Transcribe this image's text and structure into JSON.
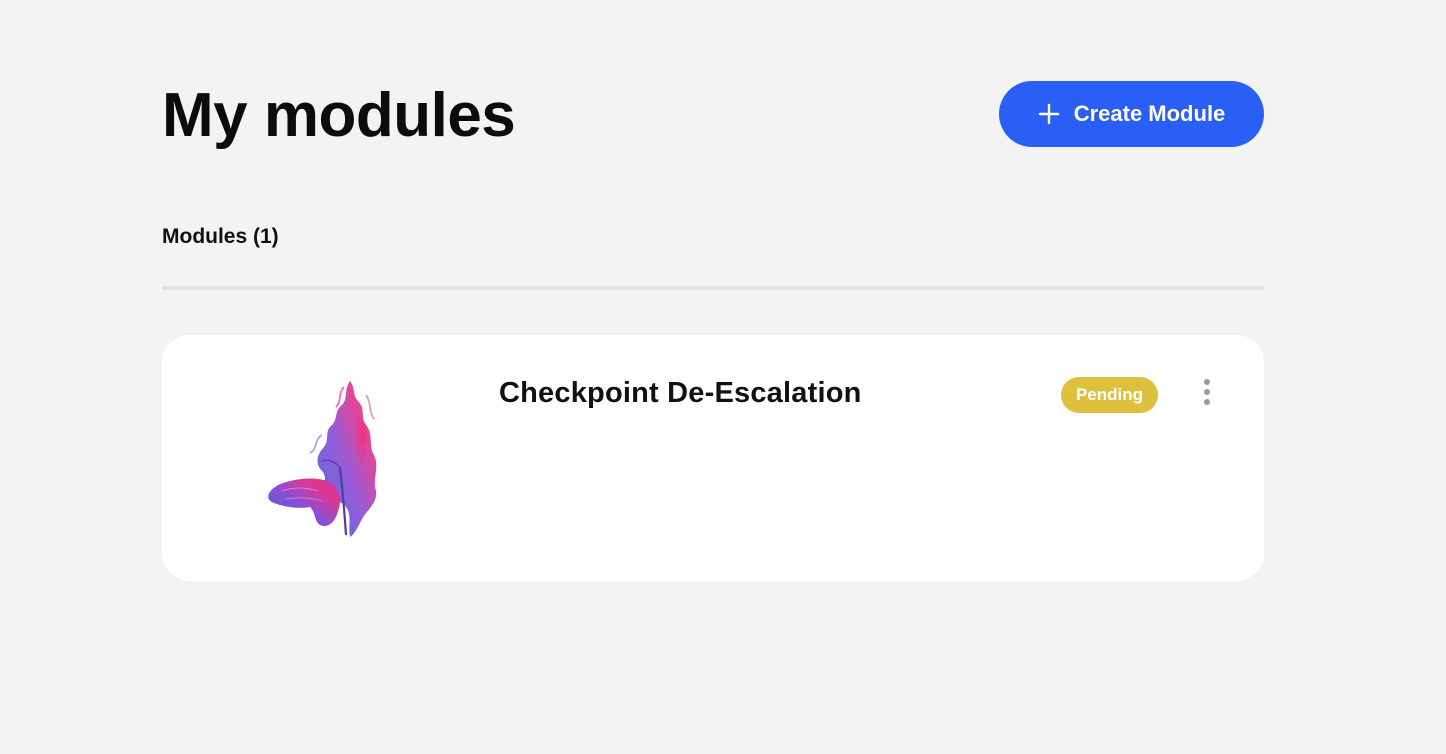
{
  "header": {
    "title": "My modules",
    "create_button_label": "Create Module",
    "create_button_icon": "plus-icon"
  },
  "modules_section": {
    "label": "Modules (1)"
  },
  "modules": [
    {
      "title": "Checkpoint De-Escalation",
      "status": "Pending",
      "thumbnail_icon": "butterfly-ink-image",
      "menu_icon": "more-vertical-icon"
    }
  ],
  "colors": {
    "background": "#f3f3f3",
    "primary_button": "#2a5ff5",
    "pending_badge": "#ddc03c",
    "card": "#ffffff",
    "divider": "#e3e3e3"
  }
}
